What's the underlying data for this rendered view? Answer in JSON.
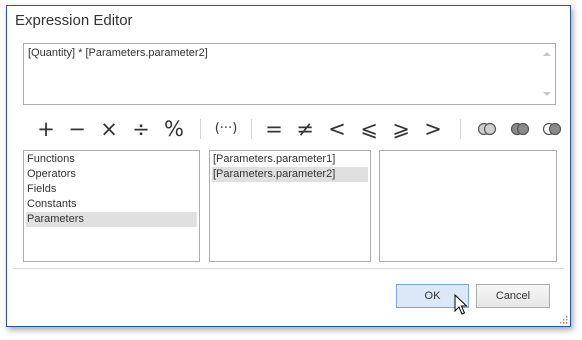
{
  "window": {
    "title": "Expression Editor"
  },
  "expression": {
    "text": "[Quantity] * [Parameters.parameter2]"
  },
  "operators": {
    "plus": "+",
    "minus": "−",
    "multiply": "×",
    "divide": "÷",
    "percent": "%",
    "parentheses": "(···)",
    "equal": "=",
    "not_equal": "≠",
    "less": "<",
    "less_equal": "⩽",
    "greater_equal": "⩾",
    "greater": ">"
  },
  "categories": {
    "items": [
      "Functions",
      "Operators",
      "Fields",
      "Constants",
      "Parameters"
    ],
    "selected": "Parameters"
  },
  "values": {
    "items": [
      "[Parameters.parameter1]",
      "[Parameters.parameter2]"
    ],
    "selected": "[Parameters.parameter2]"
  },
  "buttons": {
    "ok": "OK",
    "cancel": "Cancel"
  }
}
